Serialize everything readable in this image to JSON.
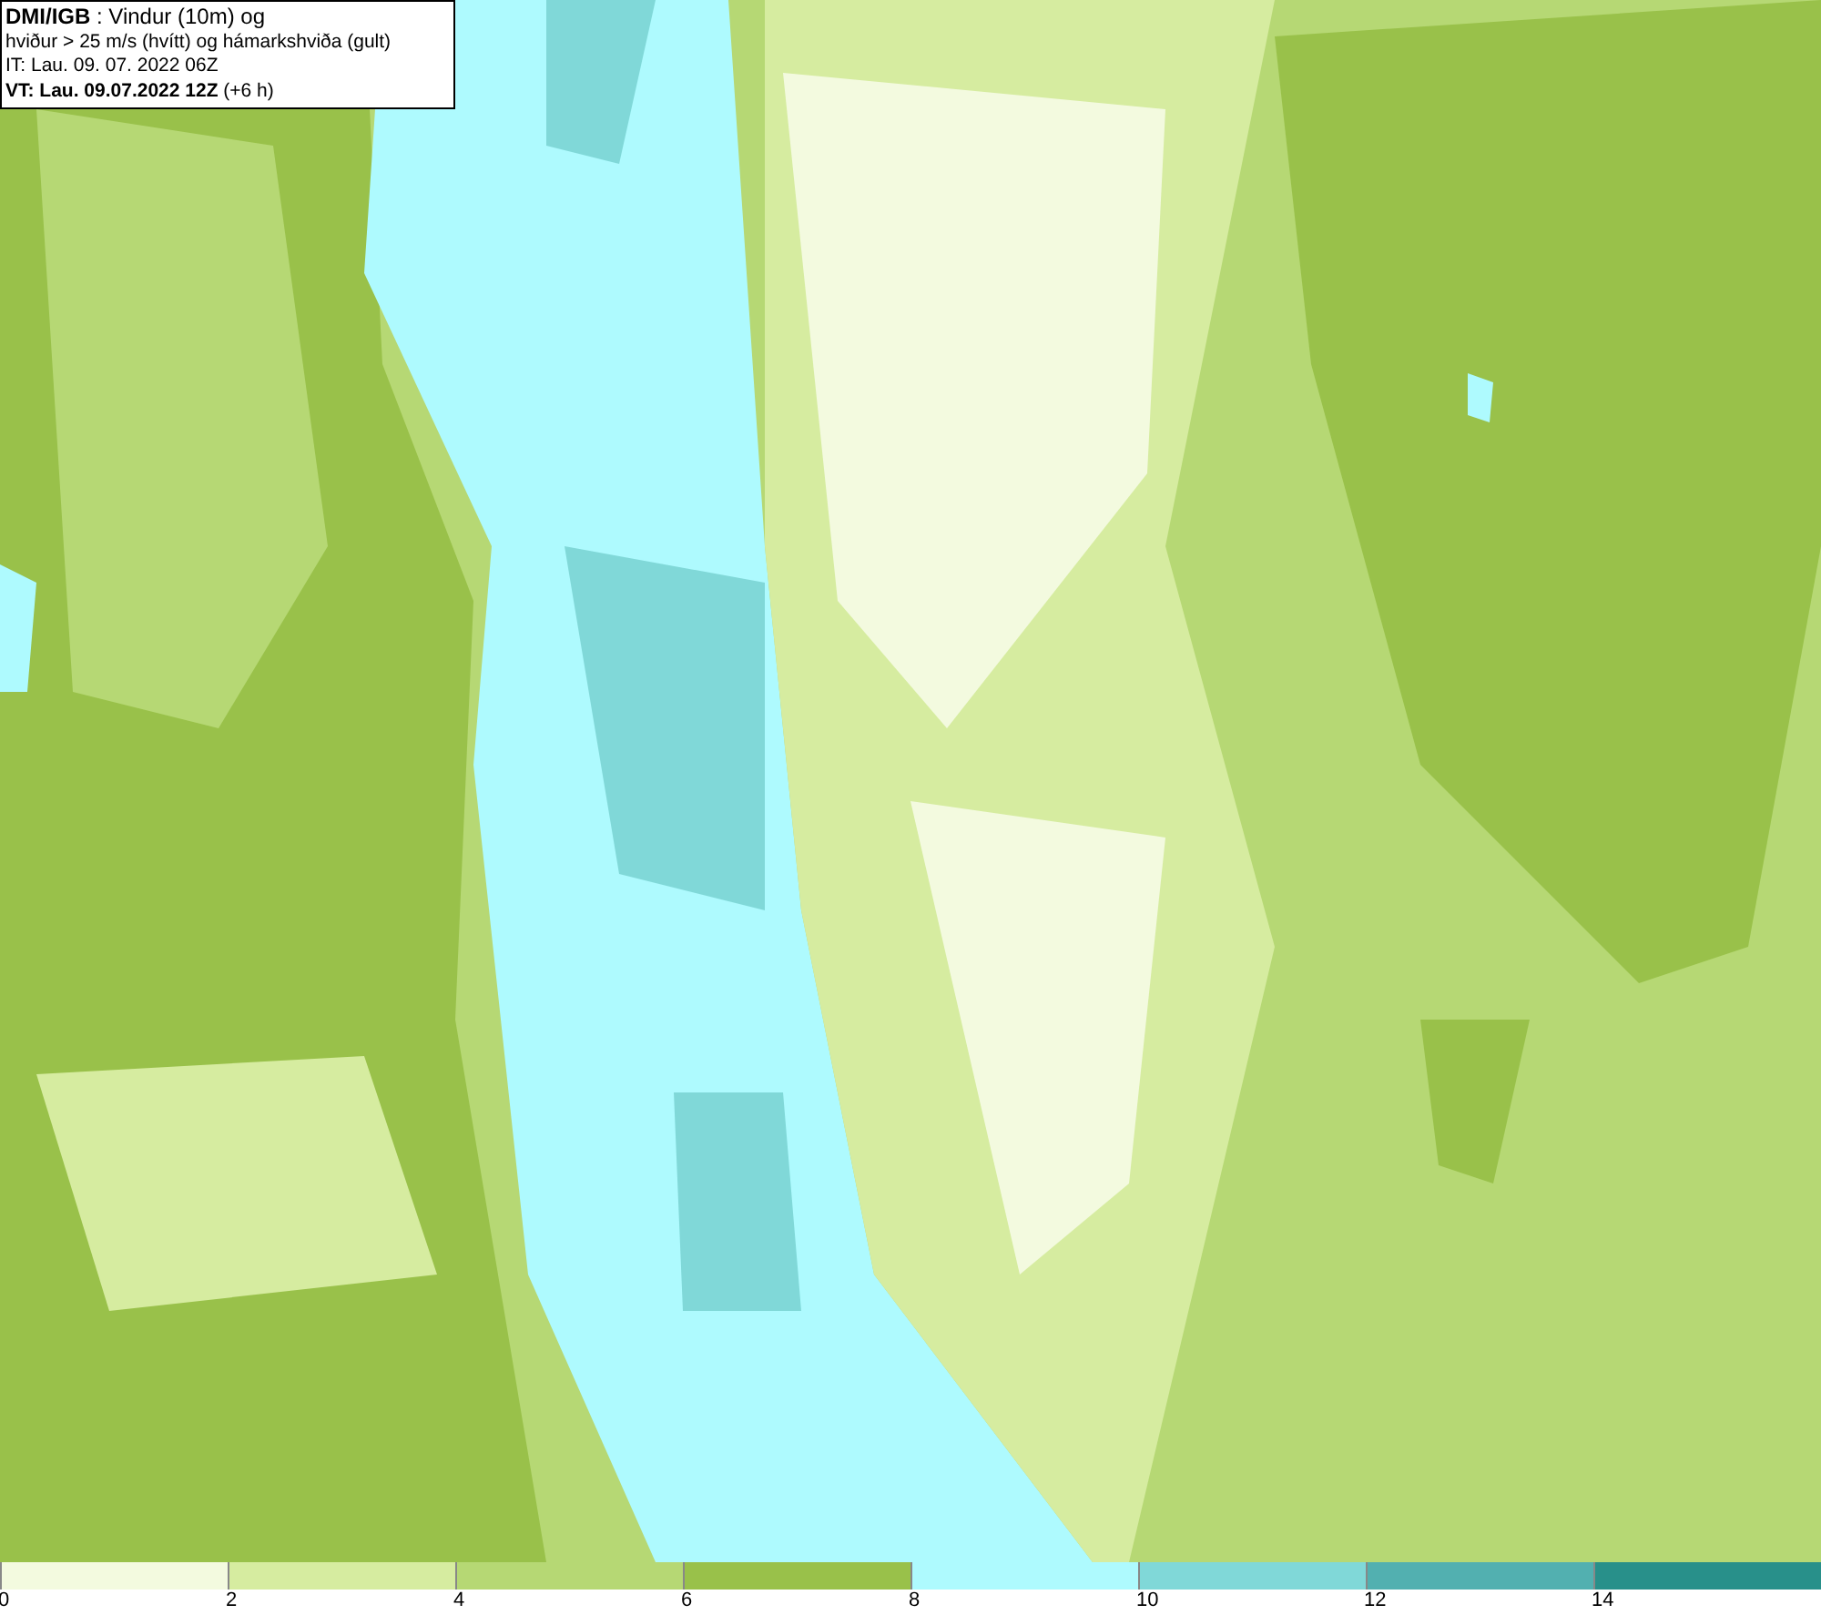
{
  "header": {
    "lines": [
      "**DMI/IGB** : Vindur (10m) og",
      "hviður > 25 m/s (hvítt) og hámarkshviða (gult)",
      "IT: Lau. 09. 07. 2022 06Z",
      "**VT: Lau. 09.07.2022 12Z** (+6 h)"
    ]
  },
  "legend": [
    {
      "label": "0",
      "color": "#f3fadf"
    },
    {
      "label": "2",
      "color": "#d6eca0"
    },
    {
      "label": "4",
      "color": "#b6d874"
    },
    {
      "label": "6",
      "color": "#99c14a"
    },
    {
      "label": "8",
      "color": "#aefafe"
    },
    {
      "label": "10",
      "color": "#80d8d8"
    },
    {
      "label": "12",
      "color": "#52b0b0"
    },
    {
      "label": "14",
      "color": "#28908a"
    }
  ]
}
